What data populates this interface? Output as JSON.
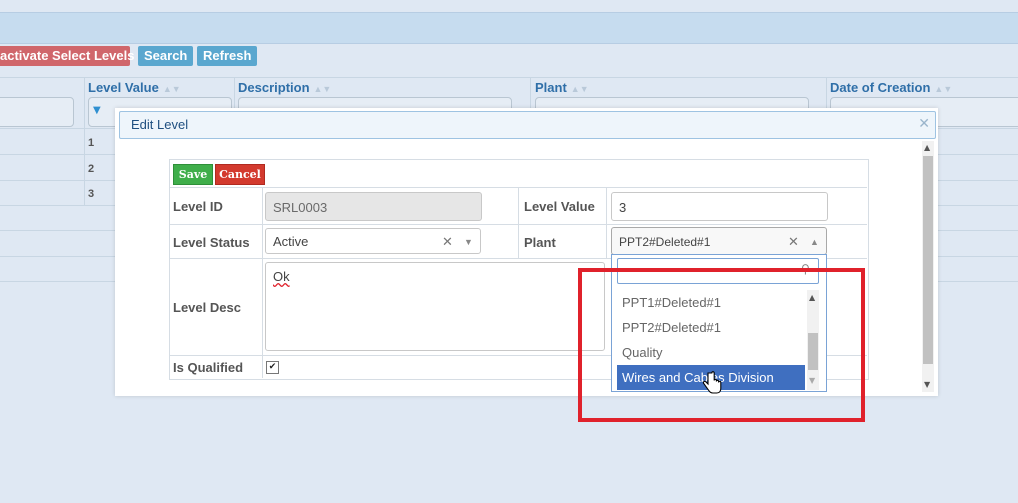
{
  "toolbar": {
    "deactivate_label": "activate Select Levels",
    "search_label": "Search",
    "refresh_label": "Refresh"
  },
  "grid": {
    "columns": [
      "Level Value",
      "Description",
      "Plant",
      "Date of Creation"
    ],
    "rows": [
      "1",
      "2",
      "3"
    ]
  },
  "modal": {
    "title": "Edit Level",
    "save_label": "Save",
    "cancel_label": "Cancel",
    "fields": {
      "level_id_label": "Level ID",
      "level_id_value": "SRL0003",
      "level_value_label": "Level Value",
      "level_value_value": "3",
      "level_status_label": "Level Status",
      "level_status_value": "Active",
      "plant_label": "Plant",
      "plant_value": "PPT2#Deleted#1",
      "level_desc_label": "Level Desc",
      "level_desc_value": "Ok",
      "is_qualified_label": "Is Qualified",
      "is_qualified_checked": true
    }
  },
  "plant_dropdown": {
    "search_value": "",
    "options": [
      "PPT1#Deleted#1",
      "PPT2#Deleted#1",
      "Quality",
      "Wires and Cables Division"
    ],
    "highlighted_option": "Wires and Cables Division"
  },
  "colors": {
    "accent_blue": "#5aa7cf",
    "danger_red": "#d0666b",
    "save_green": "#3fae4a",
    "highlight": "#3f6fc0",
    "annotation_red": "#e0212b"
  }
}
